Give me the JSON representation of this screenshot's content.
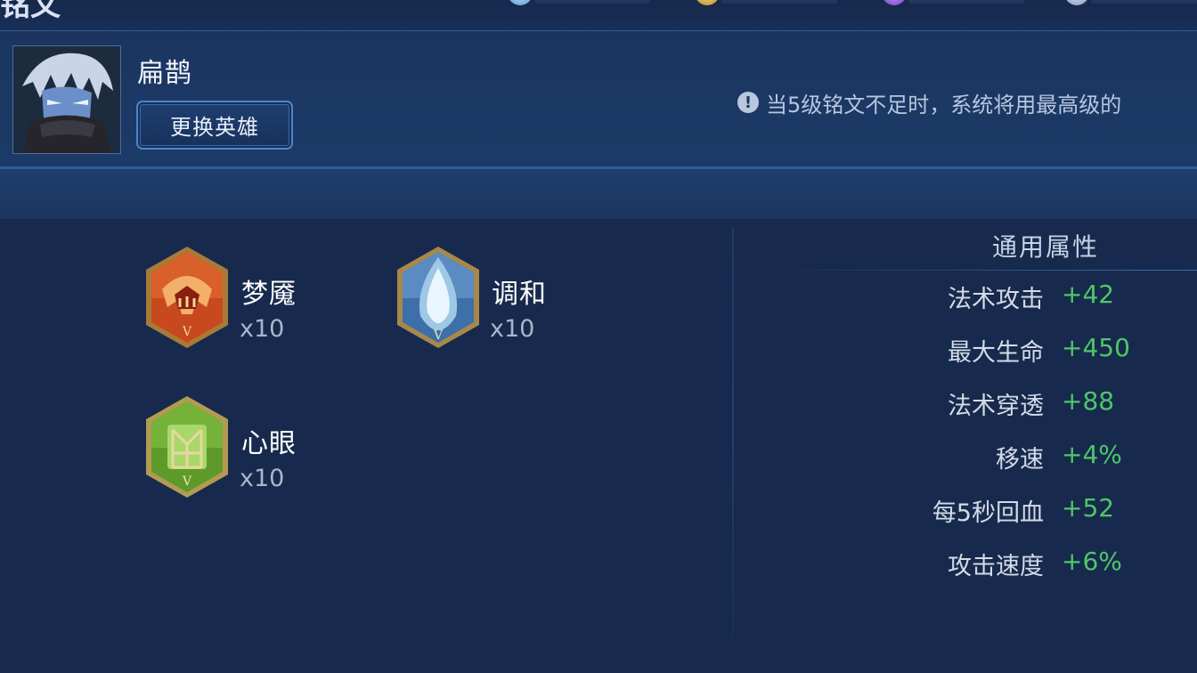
{
  "header": {
    "title": "铭文"
  },
  "hero": {
    "name": "扁鹊",
    "change_button": "更换英雄",
    "avatar_icon": "hero-portrait-icon"
  },
  "notice": {
    "icon": "exclamation-icon",
    "text": "当5级铭文不足时，系统将用最高级的"
  },
  "runes": [
    {
      "name": "梦魇",
      "count": "x10",
      "color": "#c8491d",
      "icon": "red-rune-icon"
    },
    {
      "name": "调和",
      "count": "x10",
      "color": "#3d6fa8",
      "icon": "blue-rune-icon"
    },
    {
      "name": "心眼",
      "count": "x10",
      "color": "#5d9a2a",
      "icon": "green-rune-icon"
    }
  ],
  "stats": {
    "title": "通用属性",
    "rows": [
      {
        "label": "法术攻击",
        "value": "+42"
      },
      {
        "label": "最大生命",
        "value": "+450"
      },
      {
        "label": "法术穿透",
        "value": "+88"
      },
      {
        "label": "移速",
        "value": "+4%"
      },
      {
        "label": "每5秒回血",
        "value": "+52"
      },
      {
        "label": "攻击速度",
        "value": "+6%"
      }
    ]
  },
  "colors": {
    "background": "#172a4d",
    "stat_value": "#4fc66a",
    "accent_border": "#4d85c8"
  }
}
